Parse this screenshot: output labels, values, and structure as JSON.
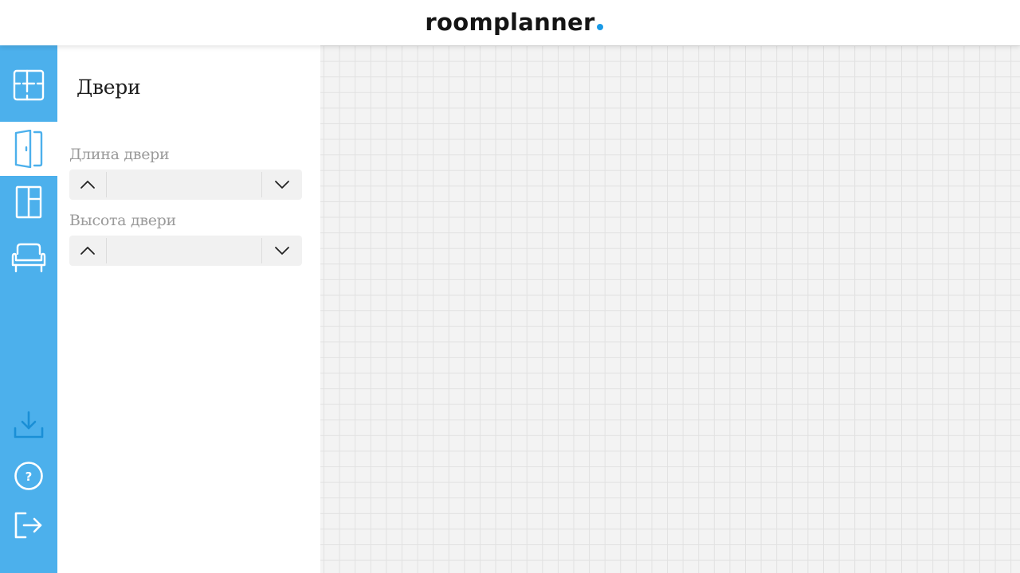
{
  "header": {
    "logo_text": "roomplanner",
    "logo_dot_color": "#1a9ae6"
  },
  "colors": {
    "rail_background": "#4cb0ec",
    "rail_icon_active": "#4cb0ec",
    "rail_icon_inactive": "#ffffff",
    "rail_bottom_icons": "#1a8fd6",
    "canvas_background": "#f3f3f3",
    "grid_line": "#e1e1e1"
  },
  "rail": {
    "tools": [
      {
        "icon": "floor-plan-icon",
        "active": false
      },
      {
        "icon": "door-icon",
        "active": true
      },
      {
        "icon": "window-icon",
        "active": false
      },
      {
        "icon": "armchair-icon",
        "active": false
      }
    ],
    "bottom": [
      {
        "icon": "download-icon"
      },
      {
        "icon": "help-icon"
      },
      {
        "icon": "exit-icon"
      }
    ]
  },
  "panel": {
    "title": "Двери",
    "fields": [
      {
        "label": "Длина двери",
        "value": "",
        "up_icon": "chevron-up-icon",
        "down_icon": "chevron-down-icon"
      },
      {
        "label": "Высота двери",
        "value": "",
        "up_icon": "chevron-up-icon",
        "down_icon": "chevron-down-icon"
      }
    ]
  }
}
